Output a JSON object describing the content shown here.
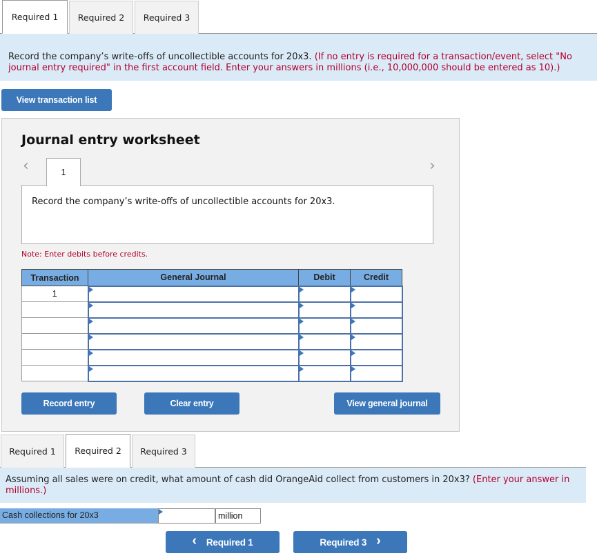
{
  "top_tabs": {
    "items": [
      {
        "label": "Required 1",
        "active": true
      },
      {
        "label": "Required 2",
        "active": false
      },
      {
        "label": "Required 3",
        "active": false
      }
    ]
  },
  "instructions_1": {
    "main": "Record the company’s write-offs of uncollectible accounts for 20x3.",
    "note": "(If no entry is required for a transaction/event, select \"No journal entry required\" in the first account field. Enter your answers in millions (i.e., 10,000,000 should be entered as 10).)"
  },
  "view_transaction_list_label": "View transaction list",
  "worksheet": {
    "title": "Journal entry worksheet",
    "prev_icon": "chevron-left-icon",
    "next_icon": "chevron-right-icon",
    "current_entry": "1",
    "entry_description": "Record the company’s write-offs of uncollectible accounts for 20x3.",
    "note": "Note: Enter debits before credits.",
    "table": {
      "headers": [
        "Transaction",
        "General Journal",
        "Debit",
        "Credit"
      ],
      "rows": [
        {
          "transaction": "1",
          "account": "",
          "debit": "",
          "credit": ""
        },
        {
          "transaction": "",
          "account": "",
          "debit": "",
          "credit": ""
        },
        {
          "transaction": "",
          "account": "",
          "debit": "",
          "credit": ""
        },
        {
          "transaction": "",
          "account": "",
          "debit": "",
          "credit": ""
        },
        {
          "transaction": "",
          "account": "",
          "debit": "",
          "credit": ""
        },
        {
          "transaction": "",
          "account": "",
          "debit": "",
          "credit": ""
        }
      ]
    },
    "buttons": {
      "record": "Record entry",
      "clear": "Clear entry",
      "view_journal": "View general journal"
    }
  },
  "bottom_tabs": {
    "items": [
      {
        "label": "Required 1",
        "active": false
      },
      {
        "label": "Required 2",
        "active": true
      },
      {
        "label": "Required 3",
        "active": false
      }
    ]
  },
  "instructions_2": {
    "main": "Assuming all sales were on credit, what amount of cash did OrangeAid collect from customers in 20x3?",
    "note": "(Enter your answer in millions.)"
  },
  "cash_collections": {
    "label": "Cash collections for 20x3",
    "value": "",
    "unit": "million"
  },
  "nav": {
    "prev_label": "Required 1",
    "prev_icon": "‹",
    "next_label": "Required 3",
    "next_icon": "›"
  }
}
